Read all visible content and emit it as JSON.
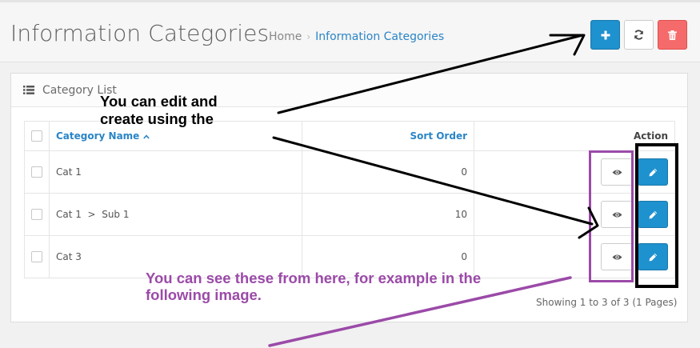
{
  "header": {
    "title": "Information Categories",
    "breadcrumb": [
      {
        "label": "Home"
      },
      {
        "label": "Information Categories"
      }
    ],
    "separator": "›",
    "buttons": [
      {
        "name": "add",
        "icon": "plus-icon",
        "color": "#1e91cf"
      },
      {
        "name": "refresh",
        "icon": "refresh-icon",
        "color": "#ffffff"
      },
      {
        "name": "delete",
        "icon": "trash-icon",
        "color": "#f56b6b"
      }
    ]
  },
  "panel": {
    "title": "Category List",
    "icon": "list-icon"
  },
  "table": {
    "columns": {
      "name": "Category Name",
      "sort_order": "Sort Order",
      "action": "Action"
    },
    "sort_indicator": "chevron-up-icon",
    "rows": [
      {
        "name": "Cat 1",
        "sort_order": "0"
      },
      {
        "name": "Cat 1  >  Sub 1",
        "sort_order": "10"
      },
      {
        "name": "Cat 3",
        "sort_order": "0"
      }
    ],
    "row_actions": [
      "eye-icon",
      "pencil-icon"
    ]
  },
  "pagination": {
    "text": "Showing 1 to 3 of 3 (1 Pages)"
  },
  "annotations": {
    "black": [
      "You can edit and",
      "create using the"
    ],
    "purple": [
      "You can see these from here, for example in the",
      "following image."
    ],
    "black_color": "#000000",
    "purple_color": "#9b4aa8"
  },
  "colors": {
    "accent": "#2a85c6",
    "primary_button": "#1e91cf",
    "danger_button": "#f56b6b"
  }
}
